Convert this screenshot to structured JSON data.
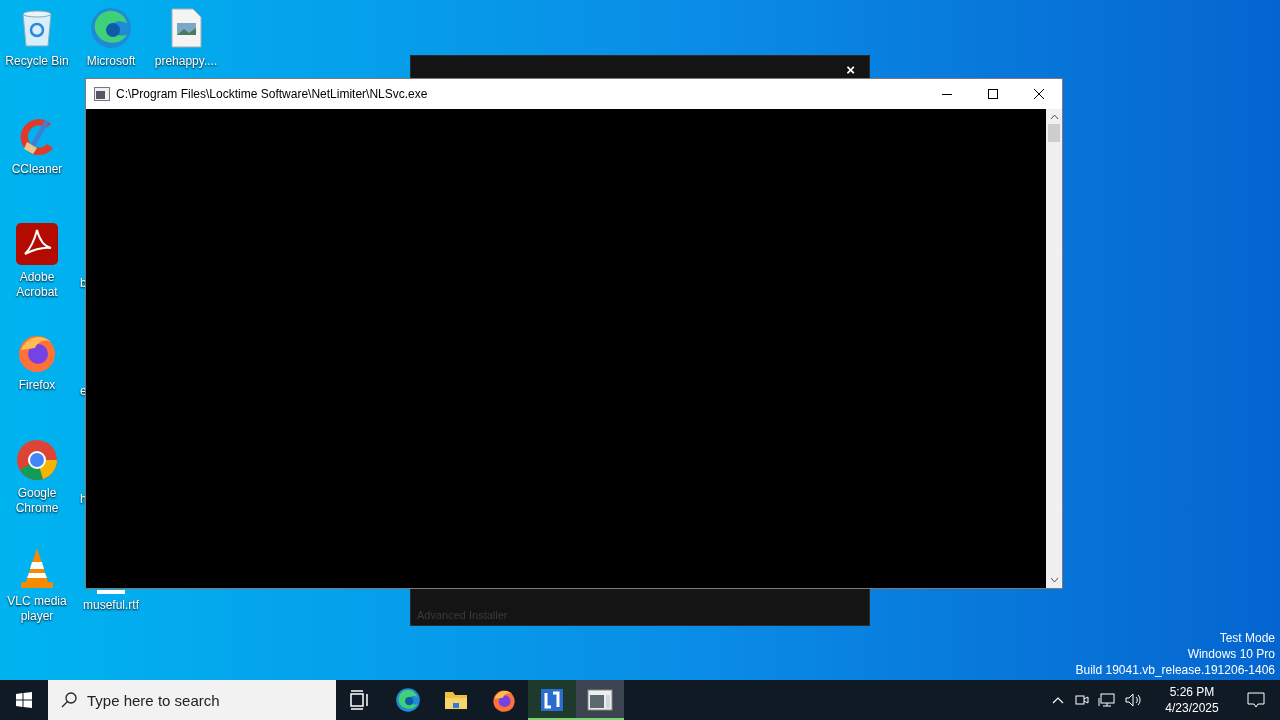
{
  "desktop_icons": [
    {
      "kind": "recycle",
      "label": "Recycle Bin"
    },
    {
      "kind": "edge",
      "label": "Microsoft"
    },
    {
      "kind": "image",
      "label": "prehappy...."
    },
    {
      "kind": "ccleaner",
      "label": "CCleaner"
    },
    {
      "kind": "acrobat",
      "label": "Adobe Acrobat"
    },
    {
      "kind": "firefox",
      "label": "Firefox"
    },
    {
      "kind": "chrome",
      "label": "Google Chrome"
    },
    {
      "kind": "vlc",
      "label": "VLC media player"
    },
    {
      "kind": "file",
      "label": "museful.rtf"
    }
  ],
  "hidden_icon_labels": [
    "b",
    "e",
    "h"
  ],
  "background_window": {
    "close": "×",
    "footer": "Advanced Installer"
  },
  "console_window": {
    "title": "C:\\Program Files\\Locktime Software\\NetLimiter\\NLSvc.exe"
  },
  "desktop_notice": [
    "Test Mode",
    "Windows 10 Pro",
    "Build 19041.vb_release.191206-1406"
  ],
  "taskbar": {
    "search_placeholder": "Type here to search",
    "apps": [
      {
        "kind": "taskview",
        "running": false,
        "selected": false
      },
      {
        "kind": "edge",
        "running": false,
        "selected": false
      },
      {
        "kind": "explorer",
        "running": false,
        "selected": false
      },
      {
        "kind": "firefox",
        "running": false,
        "selected": false
      },
      {
        "kind": "netlimiter",
        "running": true,
        "selected": false
      },
      {
        "kind": "console",
        "running": true,
        "selected": true
      }
    ],
    "time": "5:26 PM",
    "date": "4/23/2025"
  }
}
